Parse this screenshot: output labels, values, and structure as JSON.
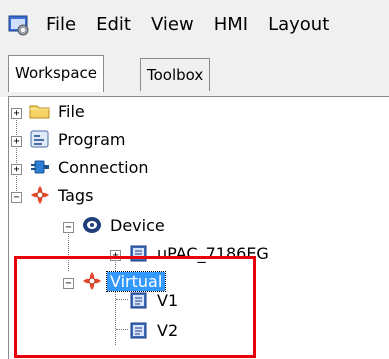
{
  "menu": {
    "items": [
      "File",
      "Edit",
      "View",
      "HMI",
      "Layout"
    ]
  },
  "tabs": [
    {
      "label": "Workspace",
      "active": true
    },
    {
      "label": "Toolbox",
      "active": false
    }
  ],
  "tree": {
    "file": {
      "label": "File",
      "icon": "folder-icon"
    },
    "program": {
      "label": "Program",
      "icon": "program-icon"
    },
    "connection": {
      "label": "Connection",
      "icon": "connection-icon"
    },
    "tags": {
      "label": "Tags",
      "icon": "tags-icon"
    },
    "device": {
      "label": "Device",
      "icon": "device-icon"
    },
    "upac": {
      "label": "uPAC_7186EG",
      "icon": "tag-item-icon"
    },
    "virtual": {
      "label": "Virtual",
      "icon": "tags-icon",
      "selected": true
    },
    "v1": {
      "label": "V1",
      "icon": "tag-item-icon"
    },
    "v2": {
      "label": "V2",
      "icon": "tag-item-icon"
    }
  },
  "colors": {
    "selection": "#3399ff",
    "highlight_border": "#e8000b"
  }
}
